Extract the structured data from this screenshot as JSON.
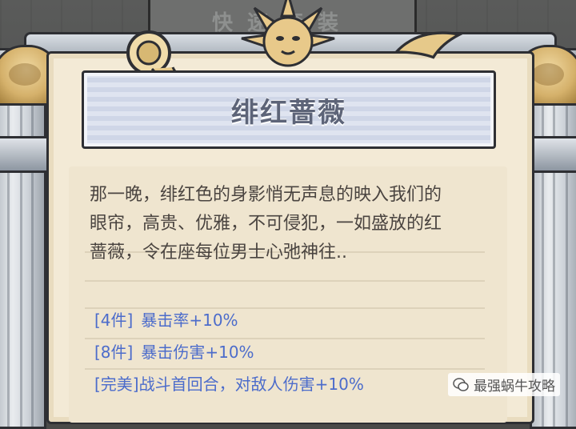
{
  "backdrop_header": "快速套装",
  "item": {
    "title": "绯红蔷薇",
    "description_lines": [
      "那一晚，绯红色的身影悄无声息的映入我们的",
      "眼帘，高贵、优雅，不可侵犯，一如盛放的红",
      "蔷薇，令在座每位男士心弛神往.."
    ],
    "bonuses": [
      {
        "tag": "[4件]",
        "effect": "暴击率+10%"
      },
      {
        "tag": "[8件]",
        "effect": "暴击伤害+10%"
      },
      {
        "tag": "[完美]",
        "effect": "战斗首回合，对敌人伤害+10%"
      }
    ]
  },
  "watermark": {
    "text": "最强蜗牛攻略",
    "icon": "wechat-icon"
  },
  "colors": {
    "title": "#5d6478",
    "bonus_text": "#4c6ccb",
    "parchment": "#f3ead6",
    "banner": "#dfe4f0"
  }
}
